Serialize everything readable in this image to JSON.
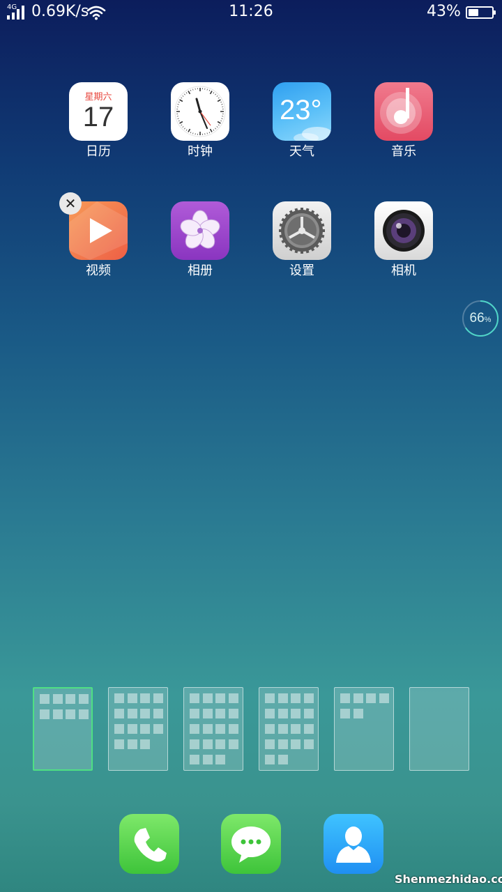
{
  "status_bar": {
    "network": "4G",
    "speed": "0.69K/s",
    "time": "11:26",
    "battery_percent": "43%",
    "battery_level": 0.43
  },
  "apps": [
    {
      "id": "calendar",
      "label": "日历",
      "icon": "calendar-icon",
      "weekday": "星期六",
      "day": "17"
    },
    {
      "id": "clock",
      "label": "时钟",
      "icon": "clock-icon"
    },
    {
      "id": "weather",
      "label": "天气",
      "icon": "weather-icon",
      "temp": "23°"
    },
    {
      "id": "music",
      "label": "音乐",
      "icon": "music-note-icon"
    },
    {
      "id": "video",
      "label": "视频",
      "icon": "play-icon"
    },
    {
      "id": "photos",
      "label": "相册",
      "icon": "flower-icon"
    },
    {
      "id": "settings",
      "label": "设置",
      "icon": "gear-icon"
    },
    {
      "id": "camera",
      "label": "相机",
      "icon": "camera-lens-icon"
    }
  ],
  "delete_badge": "✕",
  "memory_widget": {
    "value": "66",
    "unit": "%",
    "level": 0.66
  },
  "page_thumbnails": [
    {
      "page": 1,
      "active": true,
      "icon_count": 8
    },
    {
      "page": 2,
      "active": false,
      "icon_count": 15
    },
    {
      "page": 3,
      "active": false,
      "icon_count": 19
    },
    {
      "page": 4,
      "active": false,
      "icon_count": 18
    },
    {
      "page": 5,
      "active": false,
      "icon_count": 6
    },
    {
      "page": 6,
      "active": false,
      "icon_count": 0
    }
  ],
  "dock": [
    {
      "id": "phone",
      "icon": "phone-icon"
    },
    {
      "id": "messages",
      "icon": "message-bubble-icon"
    },
    {
      "id": "contacts",
      "icon": "contact-person-icon"
    }
  ],
  "watermark": "Shenmezhidao.com",
  "colors": {
    "active_page_border": "#4fe083",
    "calendar_red": "#e8453c",
    "dock_green": "#3ec43a",
    "dock_blue": "#1f8ff2"
  }
}
